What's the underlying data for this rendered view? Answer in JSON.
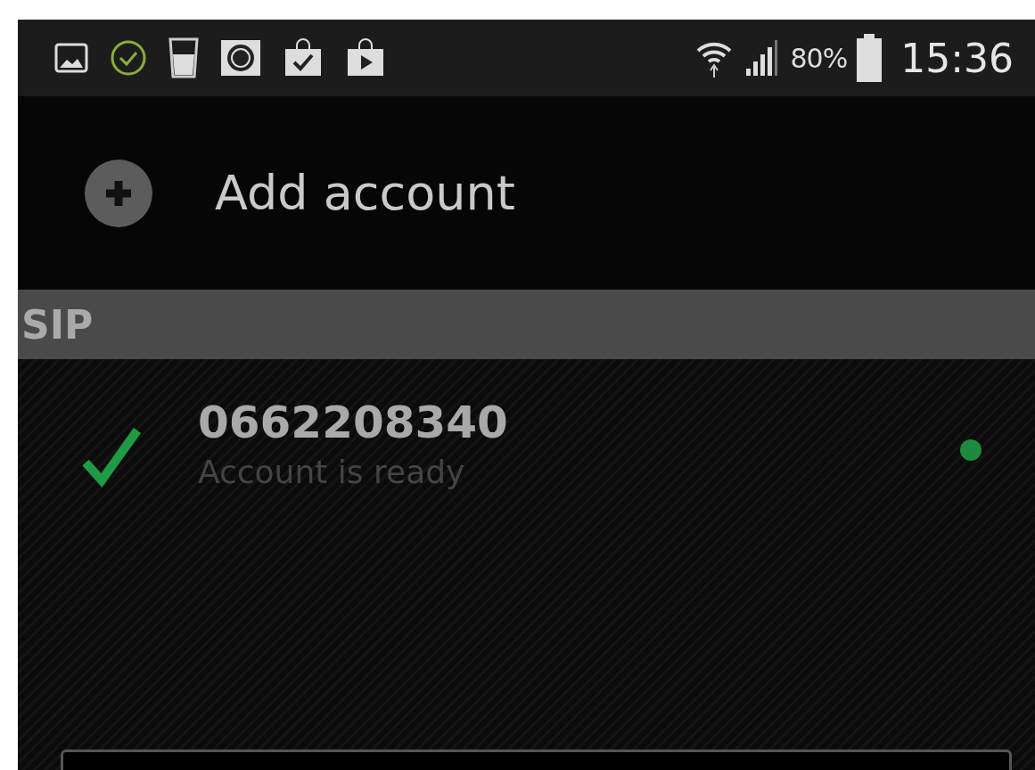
{
  "status_bar": {
    "battery": "80%",
    "time": "15:36"
  },
  "header": {
    "title": "Add account"
  },
  "sections": [
    {
      "title": "SIP",
      "accounts": [
        {
          "number": "0662208340",
          "status": "Account is ready",
          "ready": true
        }
      ]
    }
  ]
}
